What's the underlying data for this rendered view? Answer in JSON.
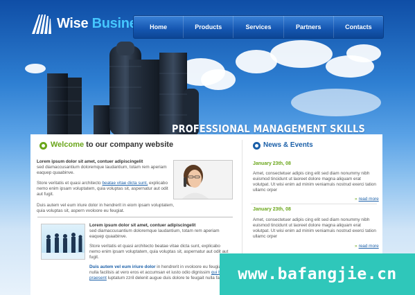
{
  "brand": {
    "name_part1": "Wise",
    "name_part2": "Business"
  },
  "nav": {
    "items": [
      "Home",
      "Products",
      "Services",
      "Partners",
      "Contacts"
    ]
  },
  "slogan": "PROFESSIONAL MANAGEMENT SKILLS",
  "welcome": {
    "title_green": "Welcome",
    "title_rest": " to our company website",
    "p1_bold": "Lorem ipsum dolor sit amet, contuer adipiscingelit",
    "p1_text": "sed diamaccusantium doloremque laudantium, totam rem aperiam eaquep quaabinve.",
    "p2_pre": "Store veritatis et quasi architecto ",
    "p2_link": "beatae vitae dicta sunt,",
    "p2_post": " explicabo nemo enim ipsam voluptatem, quia voluptas sit, aspernatur aut odit aut fugit.",
    "p3": "Duis autem vel eum iriure dolor in hendrerit in eiom ipsam voluptatem, quia voluptas sit, aspern vvoloore eu feugiat.",
    "b1_bold": "Lorem ipsum dolor sit amet, contuer adipiscingelit",
    "b1_text": "sed diamaccusantium doloremque laudantium, totam rem aperiam eaquep quaabinve.",
    "b2": "Store veritatis et quasi architecto beatae vitae dicta sunt, explicabo nemo enim ipsam voluptatem, quia voluptas sit, aspernatur aut odit aut fugit.",
    "b3_bold": "Duis autem vel eum iriure dolor",
    "b3_text": " in hendrerit in vvoloore eu feugiat nulla facilisis at vero eros et accumsan et iusto odio dignissim ",
    "b3_link": "qui blandit praesent",
    "b3_text2": " luptatum zzril delenit augue duis dolore te feugait nulla facilisi."
  },
  "news": {
    "title": "News & Events",
    "items": [
      {
        "date": "January 23th, 08",
        "text": "Amet, consectetuer adipis cing elit sed diam nonummy nibh euismod tincidunt ut laoreet dolore magna aliquam erat volutpat. Ut wisi enim ad minim veniamuis nostrud exerci tation ullamc orper",
        "more": "read more"
      },
      {
        "date": "January 23th, 08",
        "text": "Amet, consectetuer adipis cing elit sed diam nonummy nibh euismod tincidunt ut laoreet dolore magna aliquam erat volutpat. Ut wisi enim ad minim veniamuis nostrud exerci tation ullamc orper",
        "more": "read more"
      }
    ]
  },
  "watermark": "www.bafangjie.cn",
  "colors": {
    "accent_green": "#6aa61a",
    "link_blue": "#1a5fa8",
    "nav_blue": "#1556b0",
    "watermark": "#2fc7ba"
  }
}
